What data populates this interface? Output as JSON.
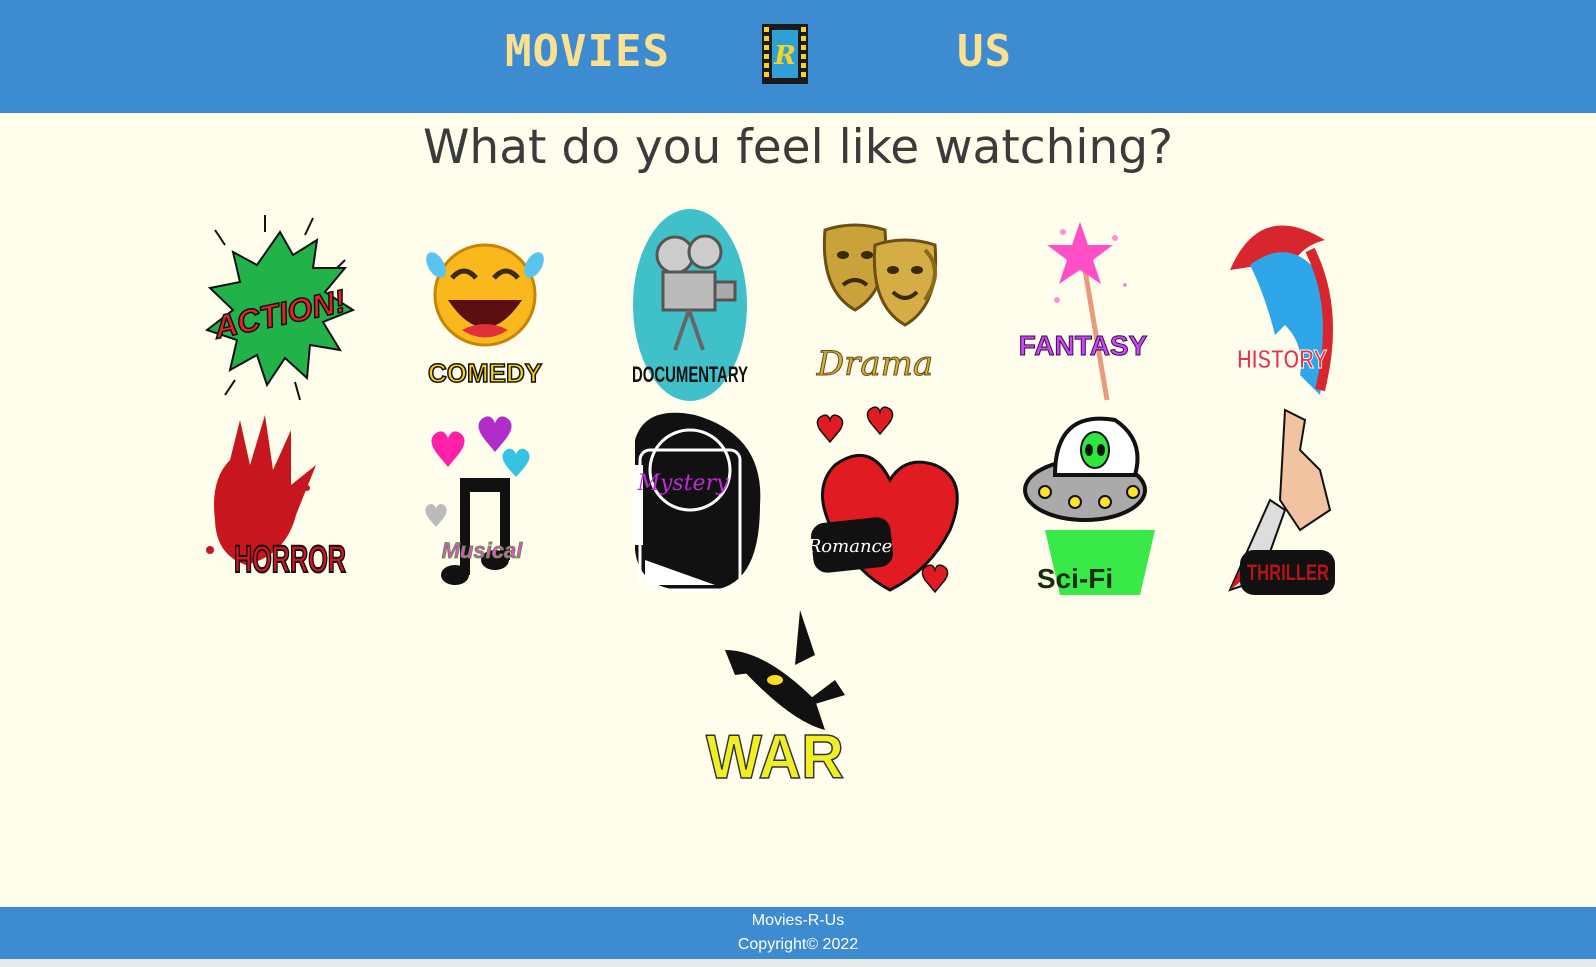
{
  "header": {
    "brand_left": "MOVIES",
    "brand_logo_letter": "R",
    "brand_right": "US"
  },
  "main": {
    "heading": "What do you feel like watching?"
  },
  "genres": [
    {
      "label": "ACTION!",
      "icon": "action-burst-icon"
    },
    {
      "label": "COMEDY",
      "icon": "laughing-face-icon"
    },
    {
      "label": "DOCUMENTARY",
      "icon": "film-camera-icon"
    },
    {
      "label": "Drama",
      "icon": "theater-masks-icon"
    },
    {
      "label": "FANTASY",
      "icon": "magic-wand-icon"
    },
    {
      "label": "HISTORY",
      "icon": "spartan-helmet-icon"
    },
    {
      "label": "HORROR",
      "icon": "bloody-hand-icon"
    },
    {
      "label": "Musical",
      "icon": "music-note-icon"
    },
    {
      "label": "Mystery",
      "icon": "mystery-silhouette-icon"
    },
    {
      "label": "Romance",
      "icon": "heart-icon"
    },
    {
      "label": "Sci-Fi",
      "icon": "ufo-alien-icon"
    },
    {
      "label": "THRILLER",
      "icon": "knife-hand-icon"
    },
    {
      "label": "WAR",
      "icon": "fighter-plane-icon"
    }
  ],
  "footer": {
    "line1": "Movies-R-Us",
    "line2": "Copyright© 2022"
  },
  "colors": {
    "header_bg": "#3d8bd0",
    "brand_text": "#fbe08f",
    "page_bg": "#fffdeb"
  }
}
